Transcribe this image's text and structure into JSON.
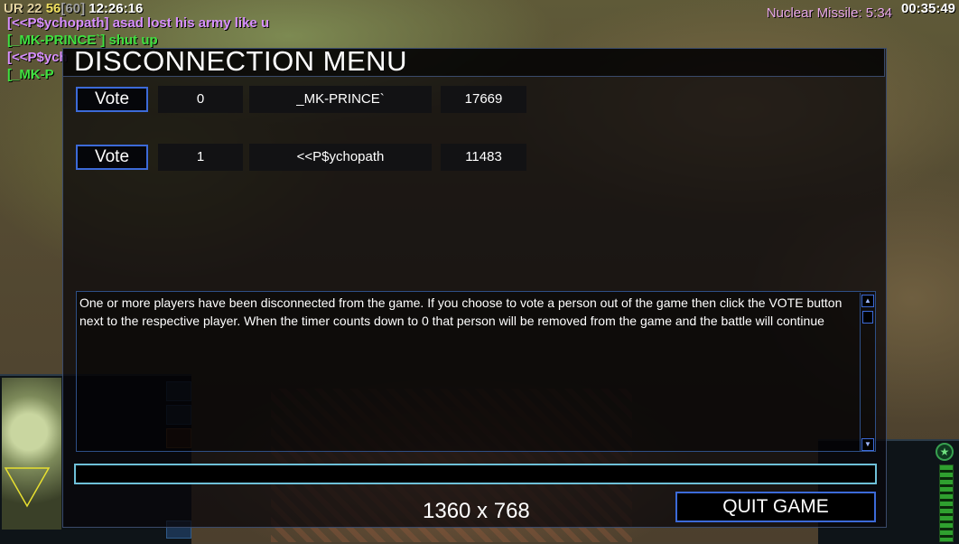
{
  "hud": {
    "ur_label": "UR",
    "ur_value": "22",
    "fps": "56",
    "fps_cap": "[60]",
    "clock": "12:26:16",
    "superweapon": "Nuclear Missile: 5:34",
    "game_time": "00:35:49"
  },
  "chat": [
    {
      "text": "[<<P$ychopath] asad lost his army like u",
      "color": "pink"
    },
    {
      "text": "[_MK-PRINCE`] shut up",
      "color": "green"
    },
    {
      "text": "[<<P$ych",
      "color": "pink"
    },
    {
      "text": "[_MK-P",
      "color": "green"
    }
  ],
  "dialog": {
    "title": "DISCONNECTION MENU",
    "players": [
      {
        "vote_label": "Vote",
        "votes": "0",
        "name": "_MK-PRINCE`",
        "ping": "17669"
      },
      {
        "vote_label": "Vote",
        "votes": "1",
        "name": "<<P$ychopath",
        "ping": "11483"
      }
    ],
    "message": "One or more players have been disconnected from the game. If you choose to vote a person out of the game then click the VOTE button next to the respective player. When the timer counts down to 0 that person will be removed from the game and the battle will continue",
    "chat_input_value": "",
    "resolution": "1360 x 768",
    "quit_label": "QUIT GAME"
  },
  "colors": {
    "accent_blue": "#3c6ad8",
    "input_border": "#6ec0d8",
    "chat_pink": "#d890ff",
    "chat_green": "#40e040"
  }
}
